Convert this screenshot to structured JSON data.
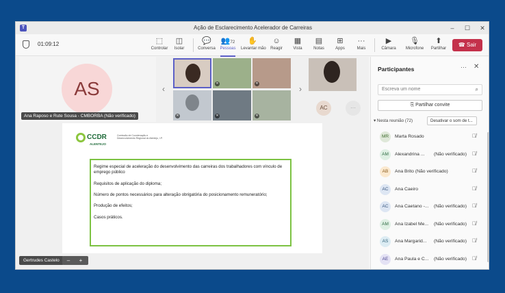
{
  "window": {
    "title": "Ação de Esclarecimento Acelerador de Carreiras",
    "minimize": "–",
    "maximize": "☐",
    "close": "✕"
  },
  "toolbar": {
    "timer": "01:09:12",
    "buttons": [
      {
        "label": "Controlar",
        "icon": "⬚"
      },
      {
        "label": "Isolar",
        "icon": "◫"
      },
      {
        "label": "Conversa",
        "icon": "💬"
      },
      {
        "label": "Pessoas",
        "icon": "👥",
        "badge": "72"
      },
      {
        "label": "Levantar mão",
        "icon": "✋"
      },
      {
        "label": "Reagir",
        "icon": "☺"
      },
      {
        "label": "Vista",
        "icon": "▦"
      },
      {
        "label": "Notas",
        "icon": "▤"
      },
      {
        "label": "Apps",
        "icon": "⊞"
      },
      {
        "label": "Mais",
        "icon": "···"
      },
      {
        "label": "Câmara",
        "icon": "▶"
      },
      {
        "label": "Microfone",
        "icon": "🎙"
      },
      {
        "label": "Partilhar",
        "icon": "⬆"
      }
    ],
    "leave_label": "Sair",
    "leave_icon": "☎",
    "leave_color": "#c4314b"
  },
  "stage": {
    "avatar_initials": "AS",
    "avatar_name": "Ana Raposo e Rute Sousa - CMBORBA (Não verificado)",
    "small_avatar": "AC",
    "bottom_name": "Gertrudes Castelo",
    "zoom_minus": "–",
    "zoom_plus": "+"
  },
  "slide": {
    "logo_text": "CCDR",
    "logo_sub": "Comissão de Coordenação e Desenvolvimento Regional do Alentejo, I.P.",
    "logo_region": "ALENTEJO",
    "items": [
      "Regime especial de aceleração do desenvolvimento das carreiras dos trabalhadores com vínculo de emprego público",
      "Requisitos de aplicação do diploma;",
      "Número de pontos necessários para alteração obrigatória do posicionamento remuneratório;",
      "Produção de efeitos;",
      "Casos práticos."
    ]
  },
  "panel": {
    "title": "Participantes",
    "search_placeholder": "Escreva um nome",
    "invite_label": "Partilhar convite",
    "section_label": "▾ Nesta reunião (72)",
    "mute_all_label": "Desativar o som de t...",
    "participants": [
      {
        "initials": "MR",
        "name": "Marta Rosado",
        "tag": "",
        "bg": "#dfe8d9",
        "fg": "#3e6b2d"
      },
      {
        "initials": "AM",
        "name": "Alexandrina ...",
        "tag": "(Não verificado)",
        "bg": "#dff0e4",
        "fg": "#2e6b42"
      },
      {
        "initials": "AB",
        "name": "Ana Brito (Não verificado)",
        "tag": "",
        "bg": "#fbe9cf",
        "fg": "#8a5a1b"
      },
      {
        "initials": "AC",
        "name": "Ana Caeiro",
        "tag": "",
        "bg": "#dde6f3",
        "fg": "#35547d"
      },
      {
        "initials": "AC",
        "name": "Ana Caetano -...",
        "tag": "(Não verificado)",
        "bg": "#dde6f3",
        "fg": "#35547d"
      },
      {
        "initials": "AM",
        "name": "Ana Izabel Me...",
        "tag": "(Não verificado)",
        "bg": "#dff0e4",
        "fg": "#2e6b42"
      },
      {
        "initials": "AS",
        "name": "Ana Margarid...",
        "tag": "(Não verificado)",
        "bg": "#dcecf3",
        "fg": "#2e6077"
      },
      {
        "initials": "AE",
        "name": "Ana Paula e C...",
        "tag": "(Não verificado)",
        "bg": "#e4e2f4",
        "fg": "#4a4590"
      }
    ]
  }
}
